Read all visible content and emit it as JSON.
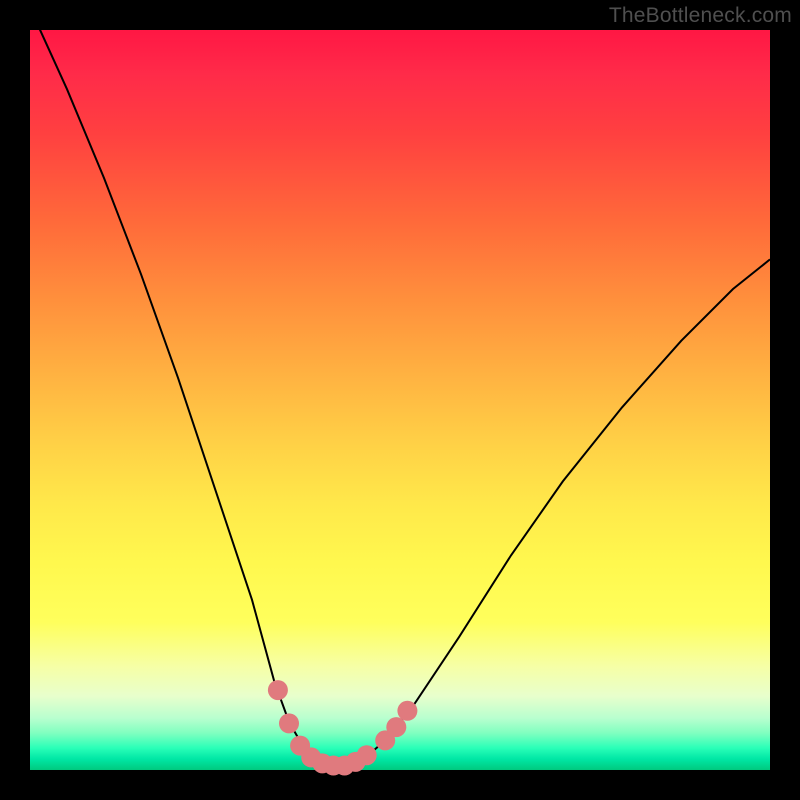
{
  "watermark": "TheBottleneck.com",
  "chart_data": {
    "type": "line",
    "title": "",
    "xlabel": "",
    "ylabel": "",
    "xlim": [
      0,
      100
    ],
    "ylim": [
      0,
      100
    ],
    "grid": false,
    "series": [
      {
        "name": "curve",
        "color": "#000000",
        "x": [
          0,
          5,
          10,
          15,
          20,
          25,
          30,
          33,
          35,
          37,
          39,
          41,
          43,
          45,
          48,
          52,
          58,
          65,
          72,
          80,
          88,
          95,
          100
        ],
        "values": [
          103,
          92,
          80,
          67,
          53,
          38,
          23,
          12,
          6.5,
          3,
          1.2,
          0.6,
          0.6,
          1.4,
          4,
          9,
          18,
          29,
          39,
          49,
          58,
          65,
          69
        ]
      },
      {
        "name": "markers",
        "color": "#e07a7e",
        "x": [
          33.5,
          35.0,
          36.5,
          38.0,
          39.5,
          41.0,
          42.5,
          44.0,
          45.5,
          48.0,
          49.5,
          51.0
        ],
        "values": [
          10.8,
          6.3,
          3.3,
          1.7,
          0.9,
          0.6,
          0.6,
          1.1,
          2.0,
          4.0,
          5.8,
          8.0
        ]
      }
    ]
  }
}
